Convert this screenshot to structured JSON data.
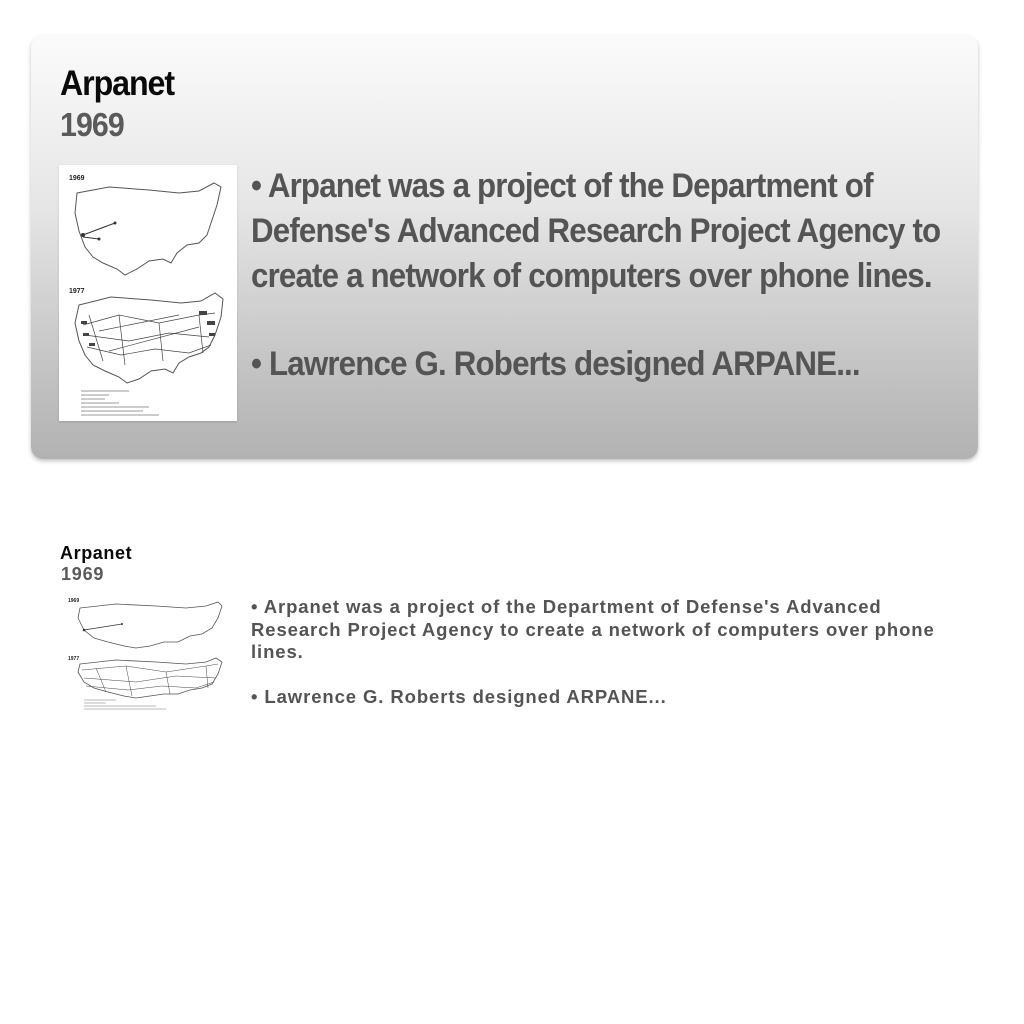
{
  "large_card": {
    "title": "Arpanet",
    "year": "1969",
    "thumbnail": {
      "icon": "arpanet-map-thumbnail",
      "label_top": "1969",
      "label_bottom": "1977"
    },
    "bullets": [
      "• Arpanet was a project of the Department of Defense's Advanced Research Project Agency to create a network of computers over phone lines.",
      "• Lawrence G. Roberts designed ARPANE..."
    ]
  },
  "small_card": {
    "title": "Arpanet",
    "year": "1969",
    "thumbnail": {
      "icon": "arpanet-map-thumbnail",
      "label_top": "1969",
      "label_bottom": "1977"
    },
    "bullets": [
      "• Arpanet was a project of the Department of Defense's Advanced Research Project Agency to create a network of computers over phone lines.",
      "• Lawrence G. Roberts designed ARPANE..."
    ]
  },
  "colors": {
    "card_gradient_top": "#fbfbfb",
    "card_gradient_bottom": "#b2b2b2",
    "title_text": "#0a0a0a",
    "body_text": "#545454",
    "year_text": "#5a5a5a"
  }
}
